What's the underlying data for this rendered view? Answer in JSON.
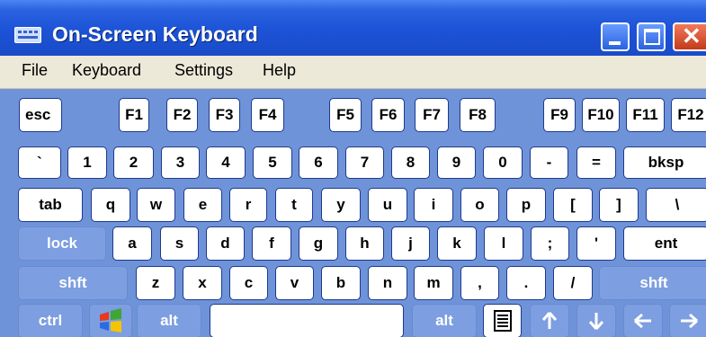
{
  "window": {
    "title": "On-Screen Keyboard",
    "title_icon": "keyboard-icon",
    "controls": {
      "minimize": "minimize-icon",
      "maximize": "maximize-icon",
      "close": "close-icon"
    }
  },
  "menu": [
    "File",
    "Keyboard",
    "Settings",
    "Help"
  ],
  "keys": {
    "esc": "esc",
    "f1": "F1",
    "f2": "F2",
    "f3": "F3",
    "f4": "F4",
    "f5": "F5",
    "f6": "F6",
    "f7": "F7",
    "f8": "F8",
    "f9": "F9",
    "f10": "F10",
    "f11": "F11",
    "f12": "F12",
    "backtick": "`",
    "d1": "1",
    "d2": "2",
    "d3": "3",
    "d4": "4",
    "d5": "5",
    "d6": "6",
    "d7": "7",
    "d8": "8",
    "d9": "9",
    "d0": "0",
    "minus": "-",
    "equals": "=",
    "bksp": "bksp",
    "tab": "tab",
    "q": "q",
    "w": "w",
    "e": "e",
    "r": "r",
    "t": "t",
    "y": "y",
    "u": "u",
    "i": "i",
    "o": "o",
    "p": "p",
    "lbracket": "[",
    "rbracket": "]",
    "backslash": "\\",
    "lock": "lock",
    "a": "a",
    "s": "s",
    "d": "d",
    "f": "f",
    "g": "g",
    "h": "h",
    "j": "j",
    "k": "k",
    "l": "l",
    "semicolon": ";",
    "quote": "'",
    "ent": "ent",
    "shft_left": "shft",
    "z": "z",
    "x": "x",
    "c": "c",
    "v": "v",
    "b": "b",
    "n": "n",
    "m": "m",
    "comma": ",",
    "period": ".",
    "slash": "/",
    "shft_right": "shft",
    "ctrl": "ctrl",
    "alt_left": "alt",
    "alt_right": "alt"
  },
  "icons": {
    "windows": "windows-logo-icon",
    "menu": "context-menu-icon",
    "up": "arrow-up-icon",
    "down": "arrow-down-icon",
    "left": "arrow-left-icon",
    "right": "arrow-right-icon"
  },
  "colors": {
    "title_bar": "#1c52d6",
    "keyboard_bg": "#6f93d9",
    "key_bg": "#ffffff",
    "modifier_key_bg": "#7d9ee0",
    "close_button": "#c43a1a"
  }
}
